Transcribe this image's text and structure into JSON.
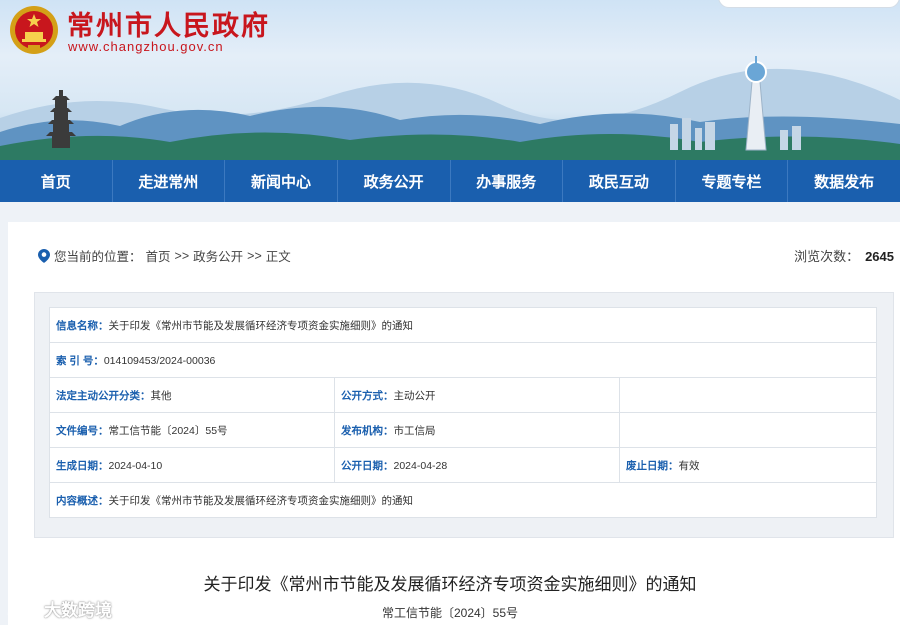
{
  "site": {
    "title": "常州市人民政府",
    "url": "www.changzhou.gov.cn"
  },
  "nav": [
    "首页",
    "走进常州",
    "新闻中心",
    "政务公开",
    "办事服务",
    "政民互动",
    "专题专栏",
    "数据发布"
  ],
  "breadcrumb": {
    "prefix": "您当前的位置：",
    "items": [
      "首页",
      ">>",
      "政务公开",
      ">>",
      "正文"
    ]
  },
  "views": {
    "label": "浏览次数：",
    "count": "2645"
  },
  "info": {
    "name_label": "信息名称：",
    "name_value": "关于印发《常州市节能及发展循环经济专项资金实施细则》的通知",
    "index_label": "索 引 号：",
    "index_value": "014109453/2024-00036",
    "category_label": "法定主动公开分类：",
    "category_value": "其他",
    "method_label": "公开方式：",
    "method_value": "主动公开",
    "docno_label": "文件编号：",
    "docno_value": "常工信节能〔2024〕55号",
    "issuer_label": "发布机构：",
    "issuer_value": "市工信局",
    "created_label": "生成日期：",
    "created_value": "2024-04-10",
    "published_label": "公开日期：",
    "published_value": "2024-04-28",
    "expiry_label": "废止日期：",
    "expiry_value": "有效",
    "summary_label": "内容概述：",
    "summary_value": "关于印发《常州市节能及发展循环经济专项资金实施细则》的通知"
  },
  "article": {
    "title": "关于印发《常州市节能及发展循环经济专项资金实施细则》的通知",
    "doc_no": "常工信节能〔2024〕55号"
  },
  "watermark": "大数跨境",
  "colors": {
    "brand_red": "#c8161d",
    "nav_blue": "#1a5fae"
  }
}
